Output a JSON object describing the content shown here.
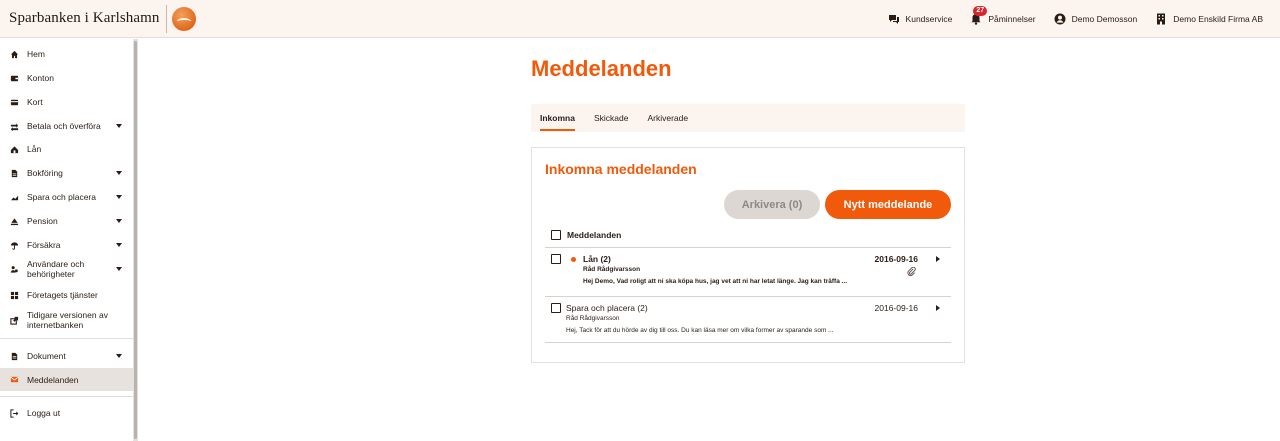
{
  "header": {
    "brand": "Sparbanken i Karlshamn",
    "customer_service": "Kundservice",
    "reminders": "Påminnelser",
    "reminders_count": "27",
    "user": "Demo Demosson",
    "company": "Demo Enskild Firma AB"
  },
  "sidebar": {
    "items": [
      {
        "label": "Hem",
        "icon": "home-icon",
        "has_caret": false
      },
      {
        "label": "Konton",
        "icon": "wallet-icon",
        "has_caret": false
      },
      {
        "label": "Kort",
        "icon": "card-icon",
        "has_caret": false
      },
      {
        "label": "Betala och överföra",
        "icon": "transfer-icon",
        "has_caret": true
      },
      {
        "label": "Lån",
        "icon": "house-icon",
        "has_caret": false
      },
      {
        "label": "Bokföring",
        "icon": "ledger-icon",
        "has_caret": true
      },
      {
        "label": "Spara och placera",
        "icon": "savings-icon",
        "has_caret": true
      },
      {
        "label": "Pension",
        "icon": "pension-icon",
        "has_caret": true
      },
      {
        "label": "Försäkra",
        "icon": "umbrella-icon",
        "has_caret": true
      },
      {
        "label": "Användare och behörigheter",
        "icon": "users-icon",
        "has_caret": true
      },
      {
        "label": "Företagets tjänster",
        "icon": "grid-icon",
        "has_caret": false
      },
      {
        "label": "Tidigare versionen av internetbanken",
        "icon": "external-icon",
        "has_caret": false
      },
      {
        "label": "Dokument",
        "icon": "document-icon",
        "has_caret": true
      },
      {
        "label": "Meddelanden",
        "icon": "mail-icon",
        "has_caret": false,
        "active": true
      },
      {
        "label": "Logga ut",
        "icon": "logout-icon",
        "has_caret": false
      }
    ]
  },
  "main": {
    "title": "Meddelanden",
    "tabs": [
      "Inkomna",
      "Skickade",
      "Arkiverade"
    ],
    "active_tab": "Inkomna",
    "card_title": "Inkomna meddelanden",
    "archive_button": "Arkivera (0)",
    "new_button": "Nytt meddelande",
    "list_header": "Meddelanden",
    "messages": [
      {
        "subject": "Lån (2)",
        "sender": "Råd Rådgivarsson",
        "preview": "Hej Demo, Vad roligt att ni ska köpa hus, jag vet att ni har letat länge. Jag kan träffa ...",
        "date": "2016-09-16",
        "unread": true,
        "attachment": true
      },
      {
        "subject": "Spara och placera (2)",
        "sender": "Råd Rådgivarsson",
        "preview": "Hej, Tack för att du hörde av dig till oss. Du kan läsa mer om vilka former av sparande som ...",
        "date": "2016-09-16",
        "unread": false,
        "attachment": false
      }
    ]
  },
  "colors": {
    "accent": "#f05a0a",
    "header_bg": "#fbf4ef",
    "active_nav_bg": "#e8e2de",
    "badge": "#d8262f"
  }
}
